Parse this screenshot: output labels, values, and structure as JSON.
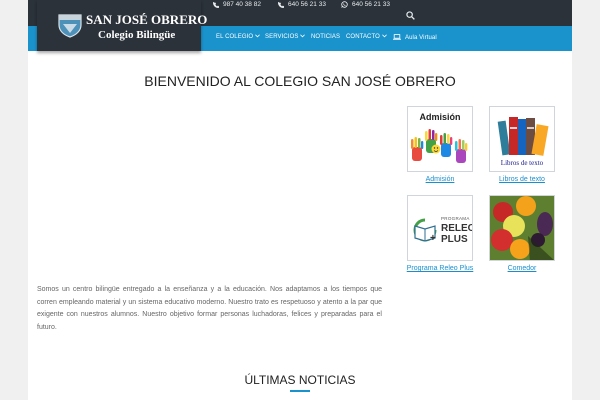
{
  "brand": {
    "name_line1": "SAN JOSÉ OBRERO",
    "name_line2": "Colegio Bilingüe",
    "logo_icon": "school-shield"
  },
  "topbar": {
    "phones": [
      {
        "icon": "phone-icon",
        "text": "987 40 38 82"
      },
      {
        "icon": "phone-icon",
        "text": "640 56 21 33"
      },
      {
        "icon": "whatsapp-icon",
        "text": "640 56 21 33"
      }
    ],
    "search_icon": "search-icon"
  },
  "nav": {
    "items": [
      {
        "label": "EL COLEGIO",
        "dropdown": true
      },
      {
        "label": "SERVICIOS",
        "dropdown": true
      },
      {
        "label": "NOTICIAS",
        "dropdown": false
      },
      {
        "label": "CONTACTO",
        "dropdown": true
      },
      {
        "label": "Aula Virtual",
        "icon": "laptop-icon"
      }
    ]
  },
  "main": {
    "title": "BIENVENIDO AL COLEGIO SAN JOSÉ OBRERO",
    "intro": "Somos un centro bilingüe entregado a la enseñanza y a la educación. Nos adaptamos a los tiempos que corren empleando material y un sistema educativo moderno. Nuestro trato es respetuoso y atento a la par que exigente con nuestros alumnos. Nuestro objetivo formar personas luchadoras, felices y preparadas para el futuro.",
    "cards": [
      {
        "label": "Admisión",
        "image_text": "Admisión"
      },
      {
        "label": "Libros de texto",
        "image_text": "Libros de texto"
      },
      {
        "label": "Programa Releo Plus",
        "image_text_small": "PROGRAMA",
        "image_text_big1": "RELEO",
        "image_text_big2": "PLUS"
      },
      {
        "label": "Comedor"
      }
    ],
    "news_title": "ÚLTIMAS NOTICIAS"
  },
  "colors": {
    "topbar": "#2b323a",
    "navbar": "#1a93cd",
    "link": "#1a8fcf",
    "accent": "#1a93cd"
  }
}
